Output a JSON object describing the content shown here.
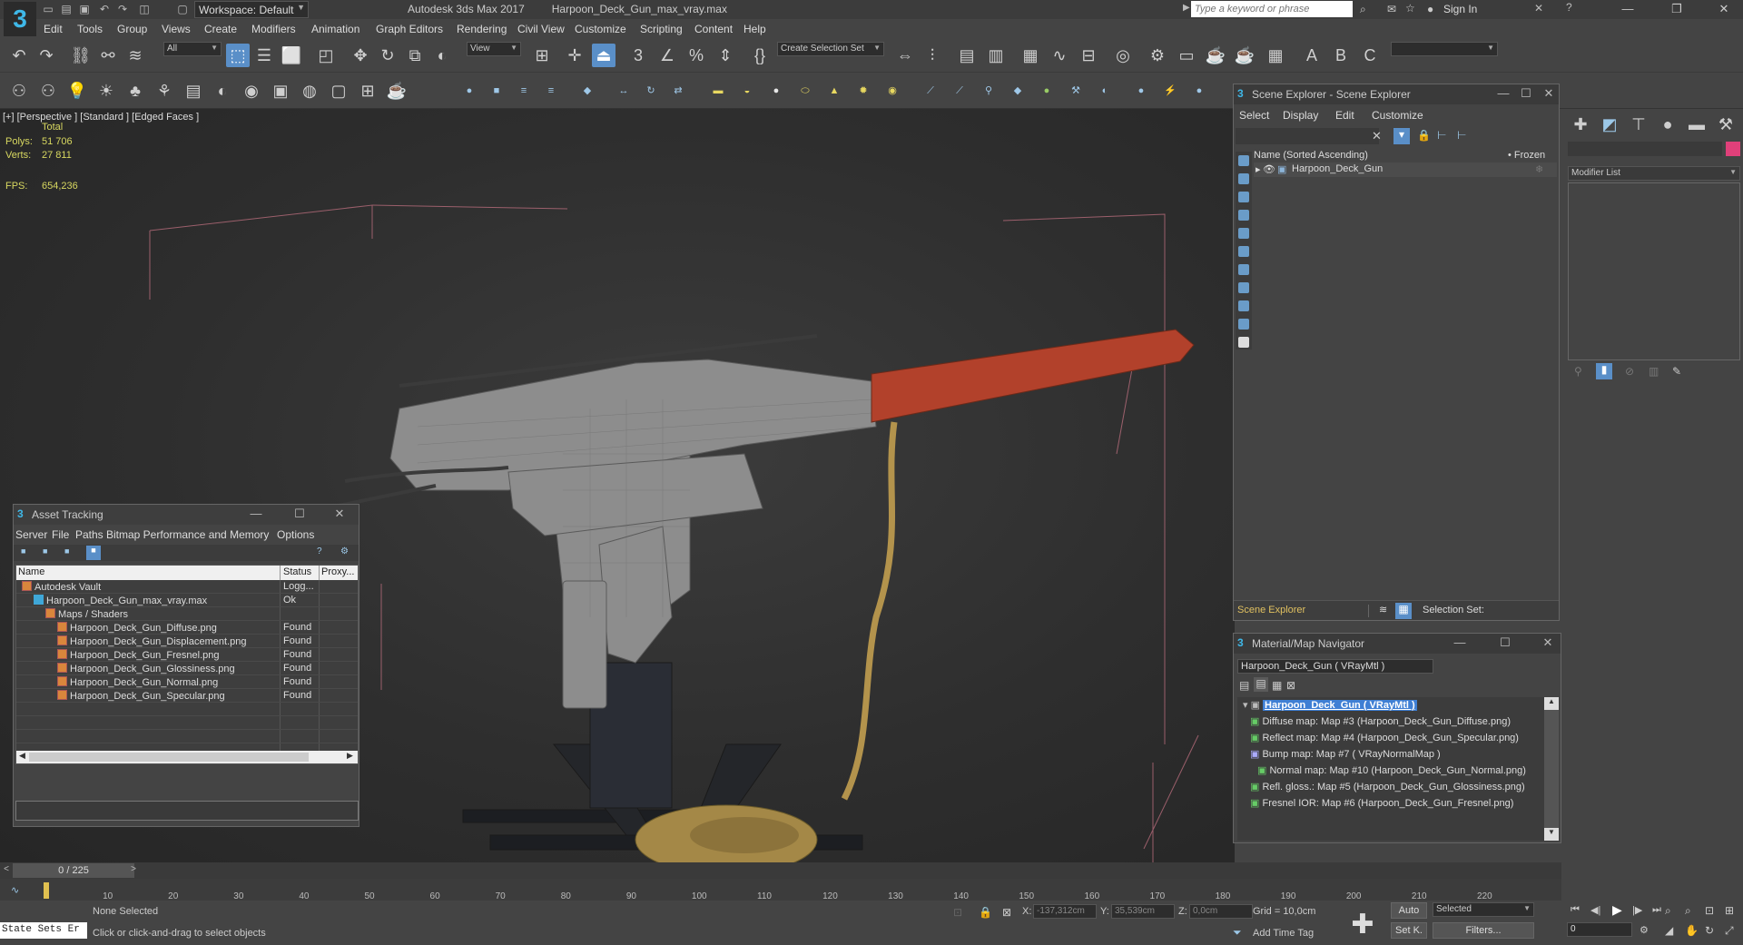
{
  "app": {
    "title": "Autodesk 3ds Max 2017",
    "file": "Harpoon_Deck_Gun_max_vray.max",
    "workspace": "Workspace: Default",
    "search_placeholder": "Type a keyword or phrase",
    "sign_in": "Sign In"
  },
  "menu": [
    "Edit",
    "Tools",
    "Group",
    "Views",
    "Create",
    "Modifiers",
    "Animation",
    "Graph Editors",
    "Rendering",
    "Civil View",
    "Customize",
    "Scripting",
    "Content",
    "Help"
  ],
  "toolbar": {
    "filter": "All",
    "ref_coord": "View",
    "selection_set": "Create Selection Set"
  },
  "viewport": {
    "label": "[+] [Perspective ] [Standard ] [Edged Faces ]",
    "stats_header": "Total",
    "polys_label": "Polys:",
    "polys_value": "51 706",
    "verts_label": "Verts:",
    "verts_value": "27 811",
    "fps_label": "FPS:",
    "fps_value": "654,236"
  },
  "scene_explorer": {
    "title": "Scene Explorer - Scene Explorer",
    "menu": [
      "Select",
      "Display",
      "Edit",
      "Customize"
    ],
    "col_name": "Name (Sorted Ascending)",
    "col_frozen": "• Frozen",
    "item": "Harpoon_Deck_Gun",
    "footer": "Scene Explorer",
    "selection_set": "Selection Set:"
  },
  "command_panel": {
    "modifier_list": "Modifier List"
  },
  "mat_nav": {
    "title": "Material/Map Navigator",
    "field": "Harpoon_Deck_Gun  ( VRayMtl )",
    "root": "Harpoon_Deck_Gun  ( VRayMtl )",
    "items": [
      "Diffuse map: Map #3 (Harpoon_Deck_Gun_Diffuse.png)",
      "Reflect map: Map #4 (Harpoon_Deck_Gun_Specular.png)",
      "Bump map: Map #7  ( VRayNormalMap )",
      "Normal map: Map #10 (Harpoon_Deck_Gun_Normal.png)",
      "Refl. gloss.: Map #5 (Harpoon_Deck_Gun_Glossiness.png)",
      "Fresnel IOR: Map #6 (Harpoon_Deck_Gun_Fresnel.png)"
    ]
  },
  "asset_tracking": {
    "title": "Asset Tracking",
    "menu": [
      "Server",
      "File",
      "Paths",
      "Bitmap Performance and Memory",
      "Options"
    ],
    "col_name": "Name",
    "col_status": "Status",
    "col_proxy": "Proxy...",
    "rows": [
      {
        "name": "Autodesk Vault",
        "status": "Logg...",
        "indent": 0,
        "kind": "vault"
      },
      {
        "name": "Harpoon_Deck_Gun_max_vray.max",
        "status": "Ok",
        "indent": 1,
        "kind": "max"
      },
      {
        "name": "Maps / Shaders",
        "status": "",
        "indent": 2,
        "kind": "folder"
      },
      {
        "name": "Harpoon_Deck_Gun_Diffuse.png",
        "status": "Found",
        "indent": 3,
        "kind": "file"
      },
      {
        "name": "Harpoon_Deck_Gun_Displacement.png",
        "status": "Found",
        "indent": 3,
        "kind": "file"
      },
      {
        "name": "Harpoon_Deck_Gun_Fresnel.png",
        "status": "Found",
        "indent": 3,
        "kind": "file"
      },
      {
        "name": "Harpoon_Deck_Gun_Glossiness.png",
        "status": "Found",
        "indent": 3,
        "kind": "file"
      },
      {
        "name": "Harpoon_Deck_Gun_Normal.png",
        "status": "Found",
        "indent": 3,
        "kind": "file"
      },
      {
        "name": "Harpoon_Deck_Gun_Specular.png",
        "status": "Found",
        "indent": 3,
        "kind": "file"
      }
    ]
  },
  "timeline": {
    "frame": "0 / 225",
    "ticks": [
      "10",
      "20",
      "30",
      "40",
      "50",
      "60",
      "70",
      "80",
      "90",
      "100",
      "110",
      "120",
      "130",
      "140",
      "150",
      "160",
      "170",
      "180",
      "190",
      "200",
      "210",
      "220"
    ]
  },
  "status": {
    "state_sets": "State Sets Er",
    "selected": "None Selected",
    "prompt": "Click or click-and-drag to select objects",
    "x_label": "X:",
    "x_value": "-137,312cm",
    "y_label": "Y:",
    "y_value": "35,539cm",
    "z_label": "Z:",
    "z_value": "0,0cm",
    "grid": "Grid = 10,0cm",
    "add_time_tag": "Add Time Tag",
    "auto": "Auto",
    "set_key": "Set K.",
    "key_filter": "Selected",
    "filters": "Filters...",
    "frame_field": "0"
  }
}
